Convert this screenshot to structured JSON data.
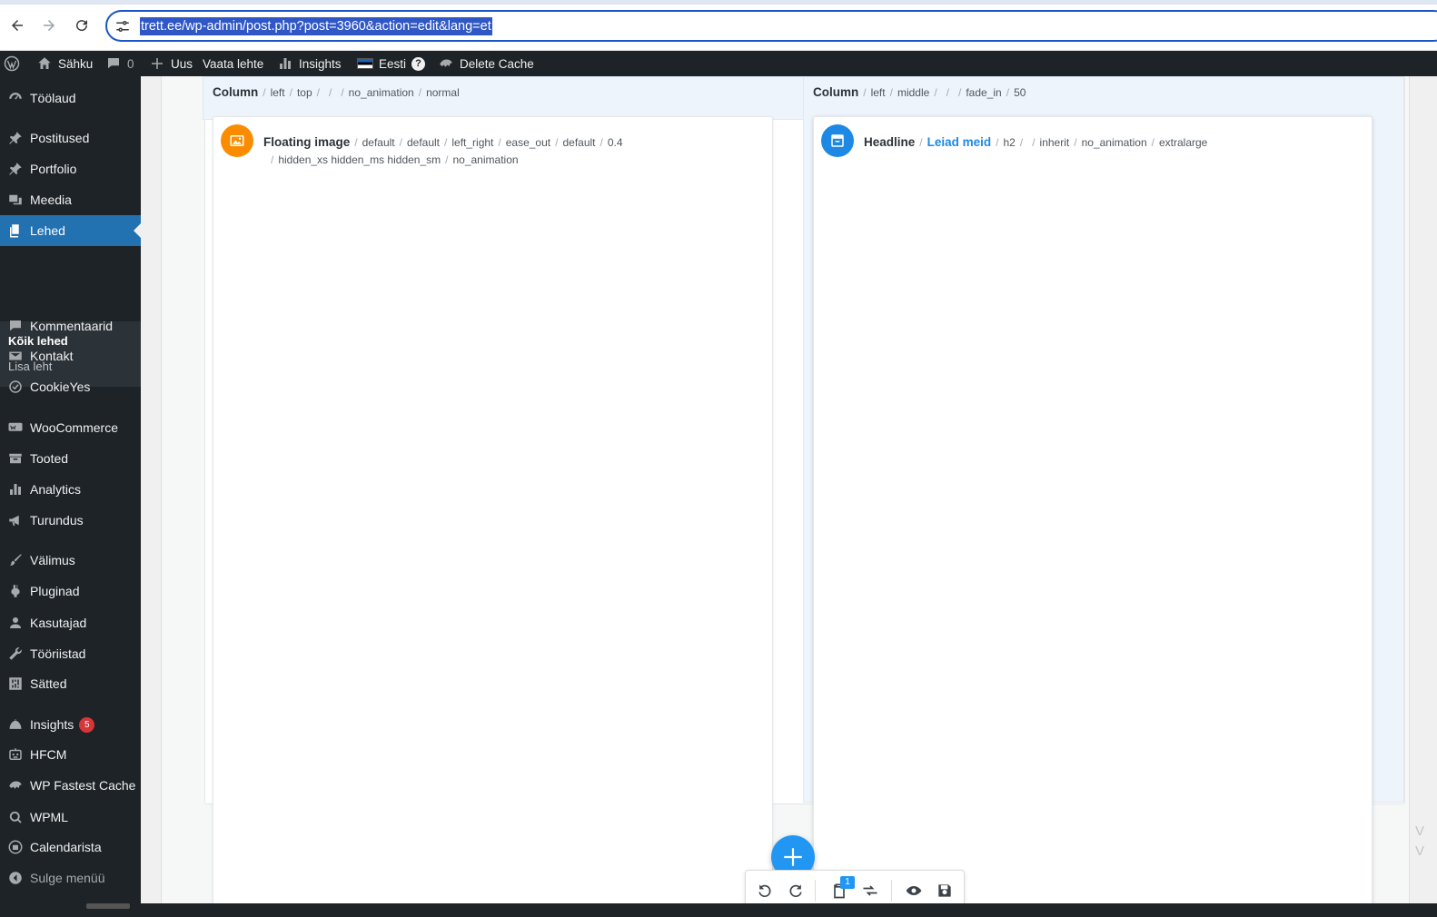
{
  "browser": {
    "url": "trett.ee/wp-admin/post.php?post=3960&action=edit&lang=et"
  },
  "adminbar": {
    "site_name": "Sähku",
    "comments_count": "0",
    "new_label": "Uus",
    "view_label": "Vaata lehte",
    "insights_label": "Insights",
    "language_label": "Eesti",
    "help_glyph": "?",
    "cache_label": "Delete Cache"
  },
  "sidebar": {
    "items": [
      {
        "label": "Töölaud",
        "icon": "dashboard-icon"
      },
      {
        "label": "Postitused",
        "icon": "pin-icon"
      },
      {
        "label": "Portfolio",
        "icon": "pin-icon"
      },
      {
        "label": "Meedia",
        "icon": "media-icon"
      },
      {
        "label": "Lehed",
        "icon": "pages-icon"
      },
      {
        "label": "Kommentaarid",
        "icon": "comment-icon"
      },
      {
        "label": "Kontakt",
        "icon": "mail-icon"
      },
      {
        "label": "CookieYes",
        "icon": "cookie-icon"
      },
      {
        "label": "WooCommerce",
        "icon": "woo-icon"
      },
      {
        "label": "Tooted",
        "icon": "archive-icon"
      },
      {
        "label": "Analytics",
        "icon": "bar-chart-icon"
      },
      {
        "label": "Turundus",
        "icon": "megaphone-icon"
      },
      {
        "label": "Välimus",
        "icon": "brush-icon"
      },
      {
        "label": "Pluginad",
        "icon": "plugin-icon"
      },
      {
        "label": "Kasutajad",
        "icon": "user-icon"
      },
      {
        "label": "Tööriistad",
        "icon": "wrench-icon"
      },
      {
        "label": "Sätted",
        "icon": "settings-icon"
      },
      {
        "label": "Insights",
        "icon": "insights-icon",
        "badge": "5"
      },
      {
        "label": "HFCM",
        "icon": "robot-icon"
      },
      {
        "label": "WP Fastest Cache",
        "icon": "cheetah-icon"
      },
      {
        "label": "WPML",
        "icon": "wpml-icon"
      },
      {
        "label": "Calendarista",
        "icon": "calendar-icon"
      }
    ],
    "submenu": [
      "Kõik lehed",
      "Lisa leht"
    ],
    "collapse_label": "Sulge menüü"
  },
  "builder": {
    "left_column": {
      "title": "Column",
      "params": [
        "left",
        "top",
        "",
        "",
        "no_animation",
        "normal"
      ],
      "element": {
        "title": "Floating image",
        "params_line1": [
          "default",
          "default",
          "left_right",
          "ease_out",
          "default",
          "0.4"
        ],
        "params_line2": [
          "hidden_xs hidden_ms hidden_sm",
          "no_animation"
        ]
      }
    },
    "right_column": {
      "title": "Column",
      "params": [
        "left",
        "middle",
        "",
        "",
        "fade_in",
        "50"
      ],
      "element": {
        "title": "Headline",
        "link_text": "Leiad meid",
        "params": [
          "h2",
          "",
          "inherit",
          "no_animation",
          "extralarge"
        ]
      }
    }
  },
  "toolbar": {
    "clipboard_count": "1"
  },
  "colors": {
    "accent": "#2271b1",
    "floating_image_icon": "#fb8c00",
    "headline_icon": "#1e88e5",
    "fab": "#2196f3",
    "badge": "#d63638"
  }
}
